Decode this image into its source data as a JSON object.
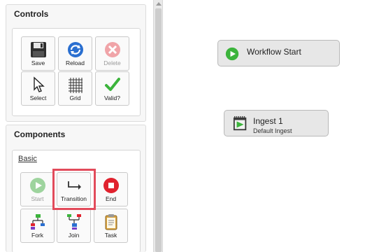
{
  "controls": {
    "title": "Controls",
    "buttons": [
      {
        "label": "Save",
        "icon": "save-icon",
        "disabled": false
      },
      {
        "label": "Reload",
        "icon": "reload-icon",
        "disabled": false
      },
      {
        "label": "Delete",
        "icon": "delete-icon",
        "disabled": true
      },
      {
        "label": "Select",
        "icon": "cursor-icon",
        "disabled": false
      },
      {
        "label": "Grid",
        "icon": "grid-icon",
        "disabled": false
      },
      {
        "label": "Valid?",
        "icon": "checkmark-icon",
        "disabled": false
      }
    ]
  },
  "components": {
    "title": "Components",
    "group_label": "Basic",
    "items": [
      {
        "label": "Start",
        "icon": "start-icon",
        "disabled": true
      },
      {
        "label": "Transition",
        "icon": "transition-icon",
        "disabled": false,
        "highlighted": true
      },
      {
        "label": "End",
        "icon": "end-icon",
        "disabled": false
      },
      {
        "label": "Fork",
        "icon": "fork-icon",
        "disabled": false
      },
      {
        "label": "Join",
        "icon": "join-icon",
        "disabled": false
      },
      {
        "label": "Task",
        "icon": "task-icon",
        "disabled": false
      }
    ]
  },
  "canvas": {
    "nodes": [
      {
        "title": "Workflow Start",
        "icon": "play-icon"
      },
      {
        "title": "Ingest 1",
        "subtitle": "Default Ingest",
        "icon": "ingest-icon"
      }
    ]
  },
  "colors": {
    "highlight": "#e24b5b",
    "start_green": "#3cb43c",
    "end_red": "#e0222e",
    "reload_blue": "#2a6fd0"
  }
}
